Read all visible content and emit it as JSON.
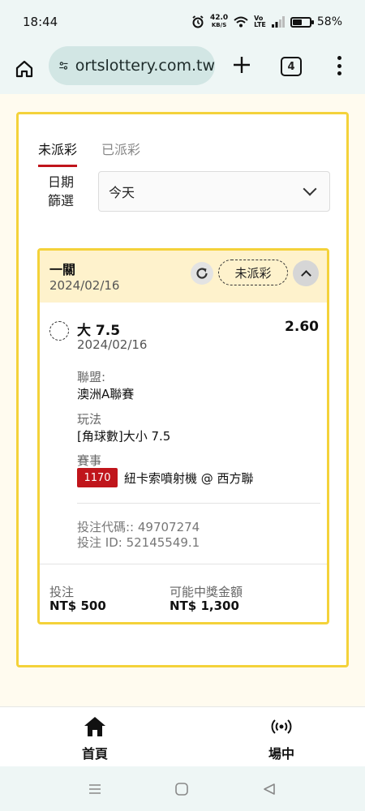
{
  "status_bar": {
    "time": "18:44",
    "net_speed_value": "42.0",
    "net_speed_unit": "KB/S",
    "volte_top": "Vo",
    "volte_bottom": "LTE",
    "battery": "58%",
    "battery_level": 0.58,
    "icons": [
      "alarm-icon",
      "wifi-icon",
      "signal-icon",
      "battery-icon"
    ]
  },
  "browser": {
    "url": "ortslottery.com.tw",
    "tab_count": "4",
    "icons": [
      "home-icon",
      "site-settings-icon",
      "new-tab-icon",
      "tab-switcher-icon",
      "more-menu-icon"
    ]
  },
  "tabs": [
    {
      "label": "未派彩",
      "active": true
    },
    {
      "label": "已派彩",
      "active": false
    }
  ],
  "filter": {
    "label": "日期篩選",
    "value": "今天"
  },
  "bet": {
    "type": "一關",
    "date": "2024/02/16",
    "status": "未派彩",
    "selection": {
      "name": "大 7.5",
      "odds": "2.60",
      "date": "2024/02/16"
    },
    "league_label": "聯盟:",
    "league": "澳洲A聯賽",
    "market_label": "玩法",
    "market": "[角球數]大小 7.5",
    "event_label": "賽事",
    "event_id": "1170",
    "event": "紐卡索噴射機 @ 西方聯",
    "code_line": "投注代碼:: 49707274",
    "id_line": "投注 ID: 52145549.1",
    "stake_label": "投注",
    "stake": "NT$ 500",
    "payout_label": "可能中獎金額",
    "payout": "NT$ 1,300",
    "colors": {
      "accent": "#f4d23a",
      "header_bg": "#fef2cc",
      "event_badge": "#c0151b"
    }
  },
  "bottom_nav": [
    {
      "label": "首頁",
      "icon": "home-icon"
    },
    {
      "label": "場中",
      "icon": "live-broadcast-icon"
    }
  ],
  "system_nav": [
    "recent-apps-icon",
    "home-circle-icon",
    "back-icon"
  ]
}
